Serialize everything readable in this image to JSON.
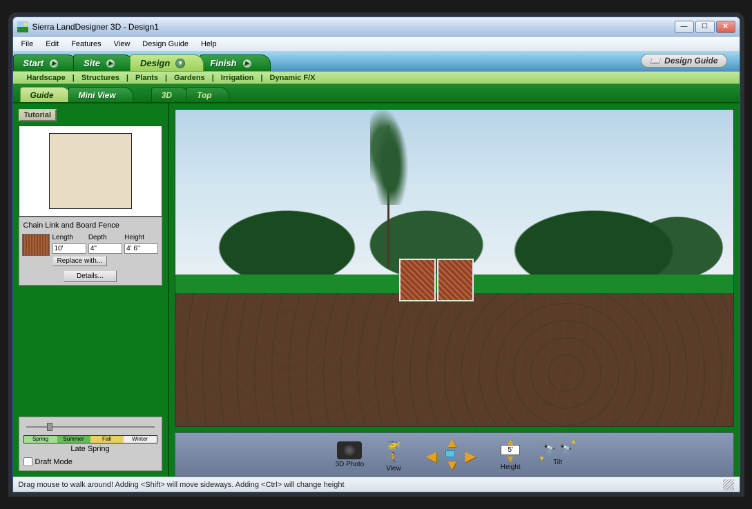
{
  "window": {
    "title": "Sierra LandDesigner 3D - Design1"
  },
  "menu": {
    "items": [
      "File",
      "Edit",
      "Features",
      "View",
      "Design Guide",
      "Help"
    ]
  },
  "steps": {
    "items": [
      {
        "label": "Start",
        "active": false
      },
      {
        "label": "Site",
        "active": false
      },
      {
        "label": "Design",
        "active": true
      },
      {
        "label": "Finish",
        "active": false
      }
    ],
    "guide_button": "Design Guide"
  },
  "categories": {
    "items": [
      "Hardscape",
      "Structures",
      "Plants",
      "Gardens",
      "Irrigation",
      "Dynamic F/X"
    ]
  },
  "view_tabs": {
    "guide": "Guide",
    "miniview": "Mini View",
    "threeD": "3D",
    "top": "Top"
  },
  "sidebar": {
    "tutorial": "Tutorial",
    "object_name": "Chain Link and Board Fence",
    "dims": {
      "length_label": "Length",
      "length": "10'",
      "depth_label": "Depth",
      "depth": "4\"",
      "height_label": "Height",
      "height": "4' 6\""
    },
    "replace_btn": "Replace with...",
    "details_btn": "Details...",
    "seasons": {
      "spring": "Spring",
      "summer": "Summer",
      "fall": "Fall",
      "winter": "Winter",
      "current": "Late Spring"
    },
    "draft_mode": "Draft Mode"
  },
  "controls": {
    "photo": "3D Photo",
    "view": "View",
    "height_label": "Height",
    "height_value": "5'",
    "tilt": "Tilt"
  },
  "status": {
    "text": "Drag mouse to walk around!  Adding <Shift> will move sideways. Adding <Ctrl> will change height"
  }
}
